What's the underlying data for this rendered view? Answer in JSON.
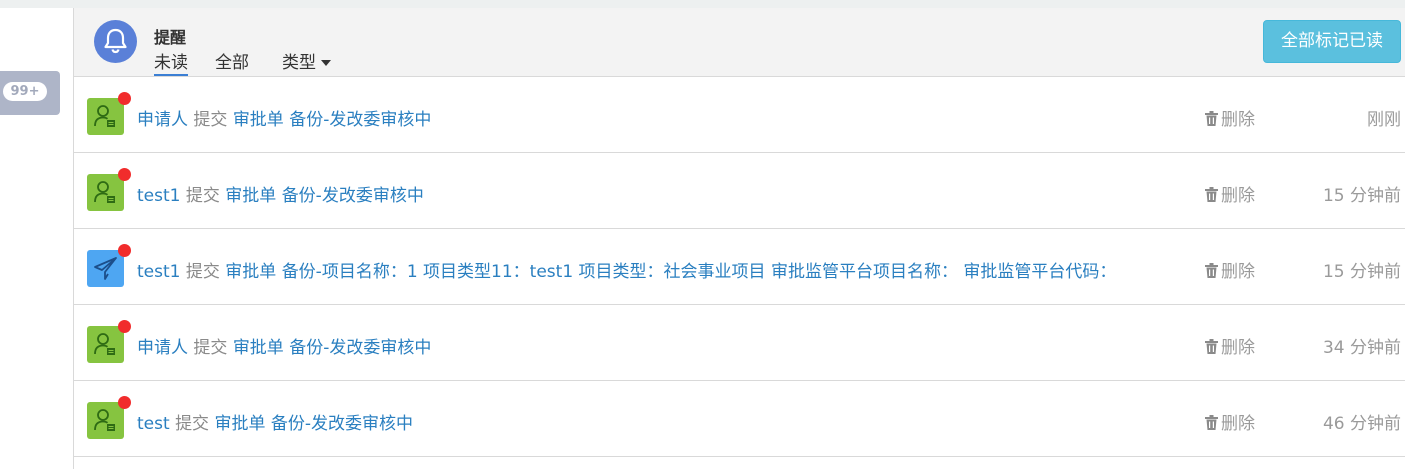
{
  "sidebar": {
    "badge": "99+"
  },
  "header": {
    "title": "提醒",
    "tabs": {
      "unread": "未读",
      "all": "全部",
      "type": "类型"
    },
    "mark_all_read": "全部标记已读"
  },
  "rows": [
    {
      "icon": "user-doc-icon",
      "sender": "申请人",
      "verb": "提交",
      "doc": "审批单",
      "subject": "备份-发改委审核中",
      "delete": "删除",
      "time": "刚刚"
    },
    {
      "icon": "user-doc-icon",
      "sender": "test1",
      "verb": "提交",
      "doc": "审批单",
      "subject": "备份-发改委审核中",
      "delete": "删除",
      "time": "15 分钟前"
    },
    {
      "icon": "paper-plane-icon",
      "sender": "test1",
      "verb": "提交",
      "doc": "审批单",
      "subject": "备份-项目名称：1 项目类型11：test1 项目类型：社会事业项目 审批监管平台项目名称： 审批监管平台代码：",
      "delete": "删除",
      "time": "15 分钟前"
    },
    {
      "icon": "user-doc-icon",
      "sender": "申请人",
      "verb": "提交",
      "doc": "审批单",
      "subject": "备份-发改委审核中",
      "delete": "删除",
      "time": "34 分钟前"
    },
    {
      "icon": "user-doc-icon",
      "sender": "test",
      "verb": "提交",
      "doc": "审批单",
      "subject": "备份-发改委审核中",
      "delete": "删除",
      "time": "46 分钟前"
    }
  ]
}
